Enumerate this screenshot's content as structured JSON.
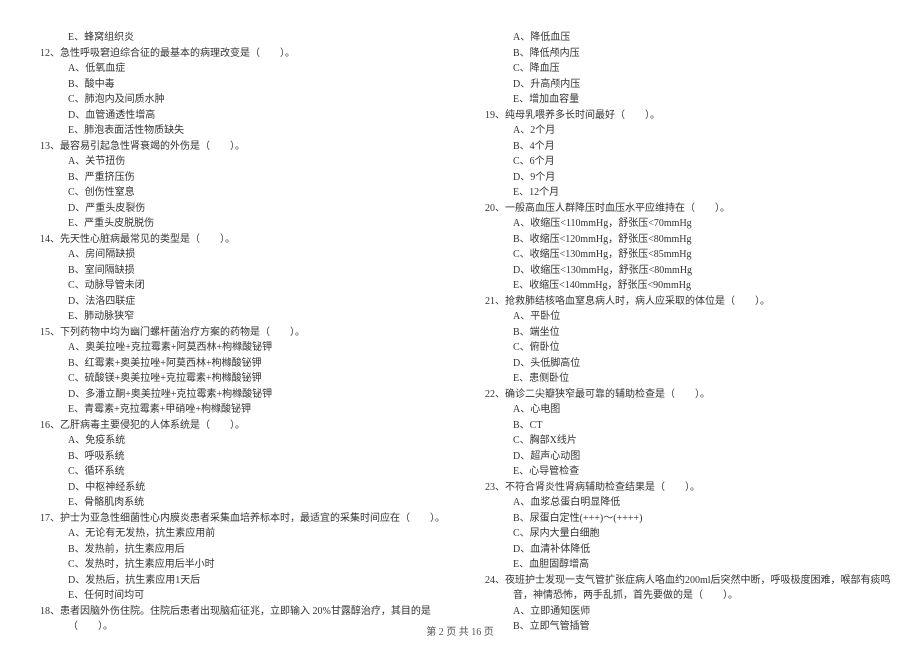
{
  "left_column": [
    {
      "type": "option",
      "text": "E、蜂窝组织炎"
    },
    {
      "type": "question",
      "text": "12、急性呼吸窘迫综合征的最基本的病理改变是（　　）。"
    },
    {
      "type": "option",
      "text": "A、低氧血症"
    },
    {
      "type": "option",
      "text": "B、酸中毒"
    },
    {
      "type": "option",
      "text": "C、肺泡内及间质水肿"
    },
    {
      "type": "option",
      "text": "D、血管通透性增高"
    },
    {
      "type": "option",
      "text": "E、肺泡表面活性物质缺失"
    },
    {
      "type": "question",
      "text": "13、最容易引起急性肾衰竭的外伤是（　　）。"
    },
    {
      "type": "option",
      "text": "A、关节扭伤"
    },
    {
      "type": "option",
      "text": "B、严重挤压伤"
    },
    {
      "type": "option",
      "text": "C、创伤性窒息"
    },
    {
      "type": "option",
      "text": "D、严重头皮裂伤"
    },
    {
      "type": "option",
      "text": "E、严重头皮脱脱伤"
    },
    {
      "type": "question",
      "text": "14、先天性心脏病最常见的类型是（　　）。"
    },
    {
      "type": "option",
      "text": "A、房间隔缺损"
    },
    {
      "type": "option",
      "text": "B、室间隔缺损"
    },
    {
      "type": "option",
      "text": "C、动脉导管未闭"
    },
    {
      "type": "option",
      "text": "D、法洛四联症"
    },
    {
      "type": "option",
      "text": "E、肺动脉狭窄"
    },
    {
      "type": "question",
      "text": "15、下列药物中均为幽门螺杆菌治疗方案的药物是（　　）。"
    },
    {
      "type": "option",
      "text": "A、奥美拉唑+克拉霉素+阿莫西林+枸橼酸铋钾"
    },
    {
      "type": "option",
      "text": "B、红霉素+奥美拉唑+阿莫西林+枸橼酸铋钾"
    },
    {
      "type": "option",
      "text": "C、硫酸镁+奥美拉唑+克拉霉素+枸橼酸铋钾"
    },
    {
      "type": "option",
      "text": "D、多潘立酮+奥美拉唑+克拉霉素+枸橼酸铋钾"
    },
    {
      "type": "option",
      "text": "E、青霉素+克拉霉素+甲硝唑+枸橼酸铋钾"
    },
    {
      "type": "question",
      "text": "16、乙肝病毒主要侵犯的人体系统是（　　）。"
    },
    {
      "type": "option",
      "text": "A、免疫系统"
    },
    {
      "type": "option",
      "text": "B、呼吸系统"
    },
    {
      "type": "option",
      "text": "C、循环系统"
    },
    {
      "type": "option",
      "text": "D、中枢神经系统"
    },
    {
      "type": "option",
      "text": "E、骨骼肌肉系统"
    },
    {
      "type": "question",
      "text": "17、护士为亚急性细菌性心内膜炎患者采集血培养标本时，最适宜的采集时间应在（　　）。"
    },
    {
      "type": "option",
      "text": "A、无论有无发热，抗生素应用前"
    },
    {
      "type": "option",
      "text": "B、发热前，抗生素应用后"
    },
    {
      "type": "option",
      "text": "C、发热时，抗生素应用后半小时"
    },
    {
      "type": "option",
      "text": "D、发热后，抗生素应用1天后"
    },
    {
      "type": "option",
      "text": "E、任何时间均可"
    },
    {
      "type": "question",
      "text": "18、患者因脑外伤住院。住院后患者出现脑疝征兆，立即输入 20%甘露醇治疗，其目的是"
    },
    {
      "type": "continuation",
      "text": "（　　）。"
    }
  ],
  "right_column": [
    {
      "type": "option",
      "text": "A、降低血压"
    },
    {
      "type": "option",
      "text": "B、降低颅内压"
    },
    {
      "type": "option",
      "text": "C、降血压"
    },
    {
      "type": "option",
      "text": "D、升高颅内压"
    },
    {
      "type": "option",
      "text": "E、增加血容量"
    },
    {
      "type": "question",
      "text": "19、纯母乳喂养多长时间最好（　　）。"
    },
    {
      "type": "option",
      "text": "A、2个月"
    },
    {
      "type": "option",
      "text": "B、4个月"
    },
    {
      "type": "option",
      "text": "C、6个月"
    },
    {
      "type": "option",
      "text": "D、9个月"
    },
    {
      "type": "option",
      "text": "E、12个月"
    },
    {
      "type": "question",
      "text": "20、一般高血压人群降压时血压水平应维持在（　　）。"
    },
    {
      "type": "option",
      "text": "A、收缩压<110mmHg，舒张压<70mmHg"
    },
    {
      "type": "option",
      "text": "B、收缩压<120mmHg，舒张压<80mmHg"
    },
    {
      "type": "option",
      "text": "C、收缩压<130mmHg，舒张压<85mmHg"
    },
    {
      "type": "option",
      "text": "D、收缩压<130mmHg，舒张压<80mmHg"
    },
    {
      "type": "option",
      "text": "E、收缩压<140mmHg，舒张压<90mmHg"
    },
    {
      "type": "question",
      "text": "21、抢救肺结核咯血窒息病人时，病人应采取的体位是（　　）。"
    },
    {
      "type": "option",
      "text": "A、平卧位"
    },
    {
      "type": "option",
      "text": "B、端坐位"
    },
    {
      "type": "option",
      "text": "C、俯卧位"
    },
    {
      "type": "option",
      "text": "D、头低脚高位"
    },
    {
      "type": "option",
      "text": "E、患侧卧位"
    },
    {
      "type": "question",
      "text": "22、确诊二尖瓣狭窄最可靠的辅助检查是（　　）。"
    },
    {
      "type": "option",
      "text": "A、心电图"
    },
    {
      "type": "option",
      "text": "B、CT"
    },
    {
      "type": "option",
      "text": "C、胸部X线片"
    },
    {
      "type": "option",
      "text": "D、超声心动图"
    },
    {
      "type": "option",
      "text": "E、心导管检查"
    },
    {
      "type": "question",
      "text": "23、不符合肾炎性肾病辅助检查结果是（　　）。"
    },
    {
      "type": "option",
      "text": "A、血浆总蛋白明显降低"
    },
    {
      "type": "option",
      "text": "B、尿蛋白定性(+++)～(++++)"
    },
    {
      "type": "option",
      "text": "C、尿内大量白细胞"
    },
    {
      "type": "option",
      "text": "D、血清补体降低"
    },
    {
      "type": "option",
      "text": "E、血胆固醇增高"
    },
    {
      "type": "question",
      "text": "24、夜班护士发现一支气管扩张症病人咯血约200ml后突然中断，呼吸极度困难，喉部有痰鸣"
    },
    {
      "type": "continuation",
      "text": "音，神情恐怖，两手乱抓，首先要做的是（　　）。"
    },
    {
      "type": "option",
      "text": "A、立即通知医师"
    },
    {
      "type": "option",
      "text": "B、立即气管插管"
    }
  ],
  "footer": "第 2 页 共 16 页"
}
